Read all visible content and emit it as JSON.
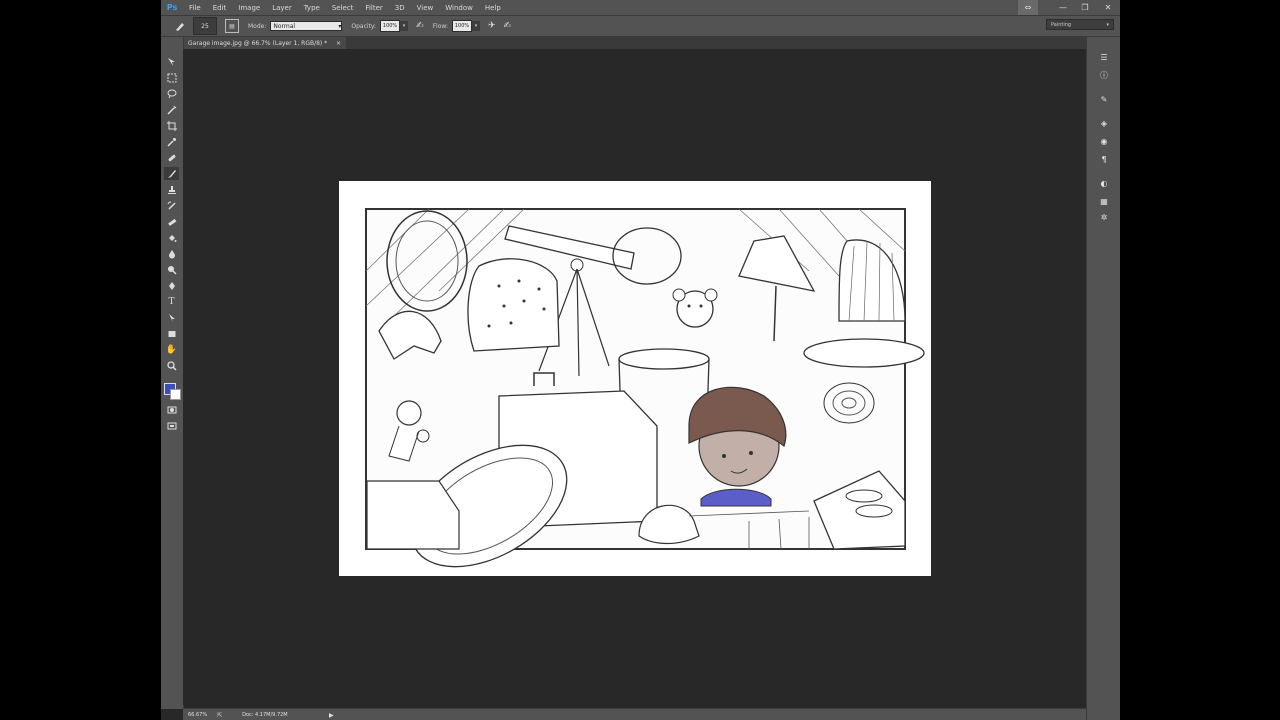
{
  "app": {
    "logo": "Ps"
  },
  "menu": [
    "File",
    "Edit",
    "Image",
    "Layer",
    "Type",
    "Select",
    "Filter",
    "3D",
    "View",
    "Window",
    "Help"
  ],
  "window_controls": [
    "⇔",
    "—",
    "❐",
    "✕"
  ],
  "options": {
    "brush_size": "25",
    "mode_label": "Mode:",
    "mode_value": "Normal",
    "opacity_label": "Opacity:",
    "opacity_value": "100%",
    "flow_label": "Flow:",
    "flow_value": "100%",
    "workspace": "Painting"
  },
  "tab": {
    "title": "Garage image.jpg @ 66.7% (Layer 1, RGB/8) *",
    "close": "×"
  },
  "colors": {
    "foreground": "#3b4fb7",
    "background": "#ffffff"
  },
  "status": {
    "zoom": "66.67%",
    "doc": "Doc: 4.17M/9.72M",
    "arrow": "▶"
  },
  "tools": [
    "move-tool",
    "marquee-tool",
    "lasso-tool",
    "quick-selection-tool",
    "crop-tool",
    "eyedropper-tool",
    "healing-brush-tool",
    "brush-tool",
    "clone-stamp-tool",
    "history-brush-tool",
    "eraser-tool",
    "paint-bucket-tool",
    "blur-tool",
    "dodge-tool",
    "pen-tool",
    "type-tool",
    "path-selection-tool",
    "shape-tool",
    "hand-tool",
    "zoom-tool"
  ],
  "right_panels": [
    "history-panel-icon",
    "info-panel-icon",
    "brush-presets-panel-icon",
    "layers-panel-icon",
    "channels-panel-icon",
    "character-panel-icon",
    "adjustments-panel-icon",
    "swatches-panel-icon",
    "styles-panel-icon"
  ]
}
